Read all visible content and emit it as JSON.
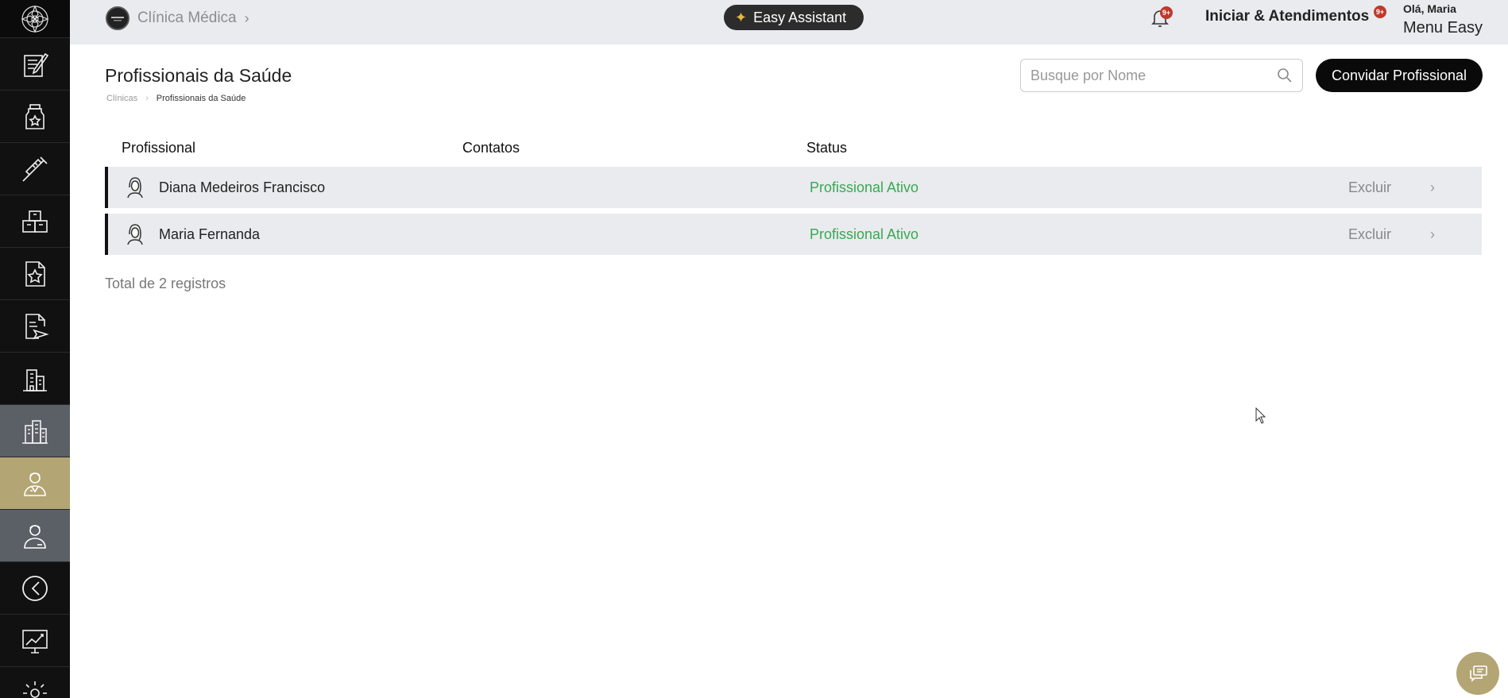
{
  "topbar": {
    "clinic_name": "Clínica Médica",
    "assistant_label": "Easy Assistant",
    "notifications_badge": "9+",
    "iniciar_label": "Iniciar & Atendimentos",
    "iniciar_badge": "9+",
    "greeting": "Olá, Maria",
    "menu_label": "Menu Easy"
  },
  "sidebar": {
    "items": [
      {
        "icon": "edit-document-icon"
      },
      {
        "icon": "medicine-bottle-icon"
      },
      {
        "icon": "syringe-icon"
      },
      {
        "icon": "inventory-boxes-icon"
      },
      {
        "icon": "favorite-document-icon"
      },
      {
        "icon": "send-document-icon"
      },
      {
        "icon": "building-icon"
      },
      {
        "icon": "clinic-buildings-icon",
        "state": "active-gray"
      },
      {
        "icon": "doctor-icon",
        "state": "active-gold"
      },
      {
        "icon": "professional-icon",
        "state": "active-gray"
      },
      {
        "icon": "history-clock-icon"
      },
      {
        "icon": "financial-chart-icon"
      },
      {
        "icon": "settings-gear-icon"
      }
    ]
  },
  "page": {
    "title": "Profissionais da Saúde",
    "breadcrumb": [
      "Clínicas",
      "Profissionais da Saúde"
    ],
    "search_placeholder": "Busque por Nome",
    "invite_label": "Convidar Profissional"
  },
  "table": {
    "columns": [
      "Profissional",
      "Contatos",
      "Status"
    ],
    "rows": [
      {
        "name": "Diana Medeiros Francisco",
        "contacts": "",
        "status": "Profissional Ativo",
        "action": "Excluir"
      },
      {
        "name": "Maria Fernanda",
        "contacts": "",
        "status": "Profissional Ativo",
        "action": "Excluir"
      }
    ],
    "total": "Total de 2 registros"
  },
  "colors": {
    "accent_gold": "#b3a574",
    "status_green": "#3aa854",
    "sidebar_bg": "#111111",
    "topbar_bg": "#e9ebee"
  }
}
